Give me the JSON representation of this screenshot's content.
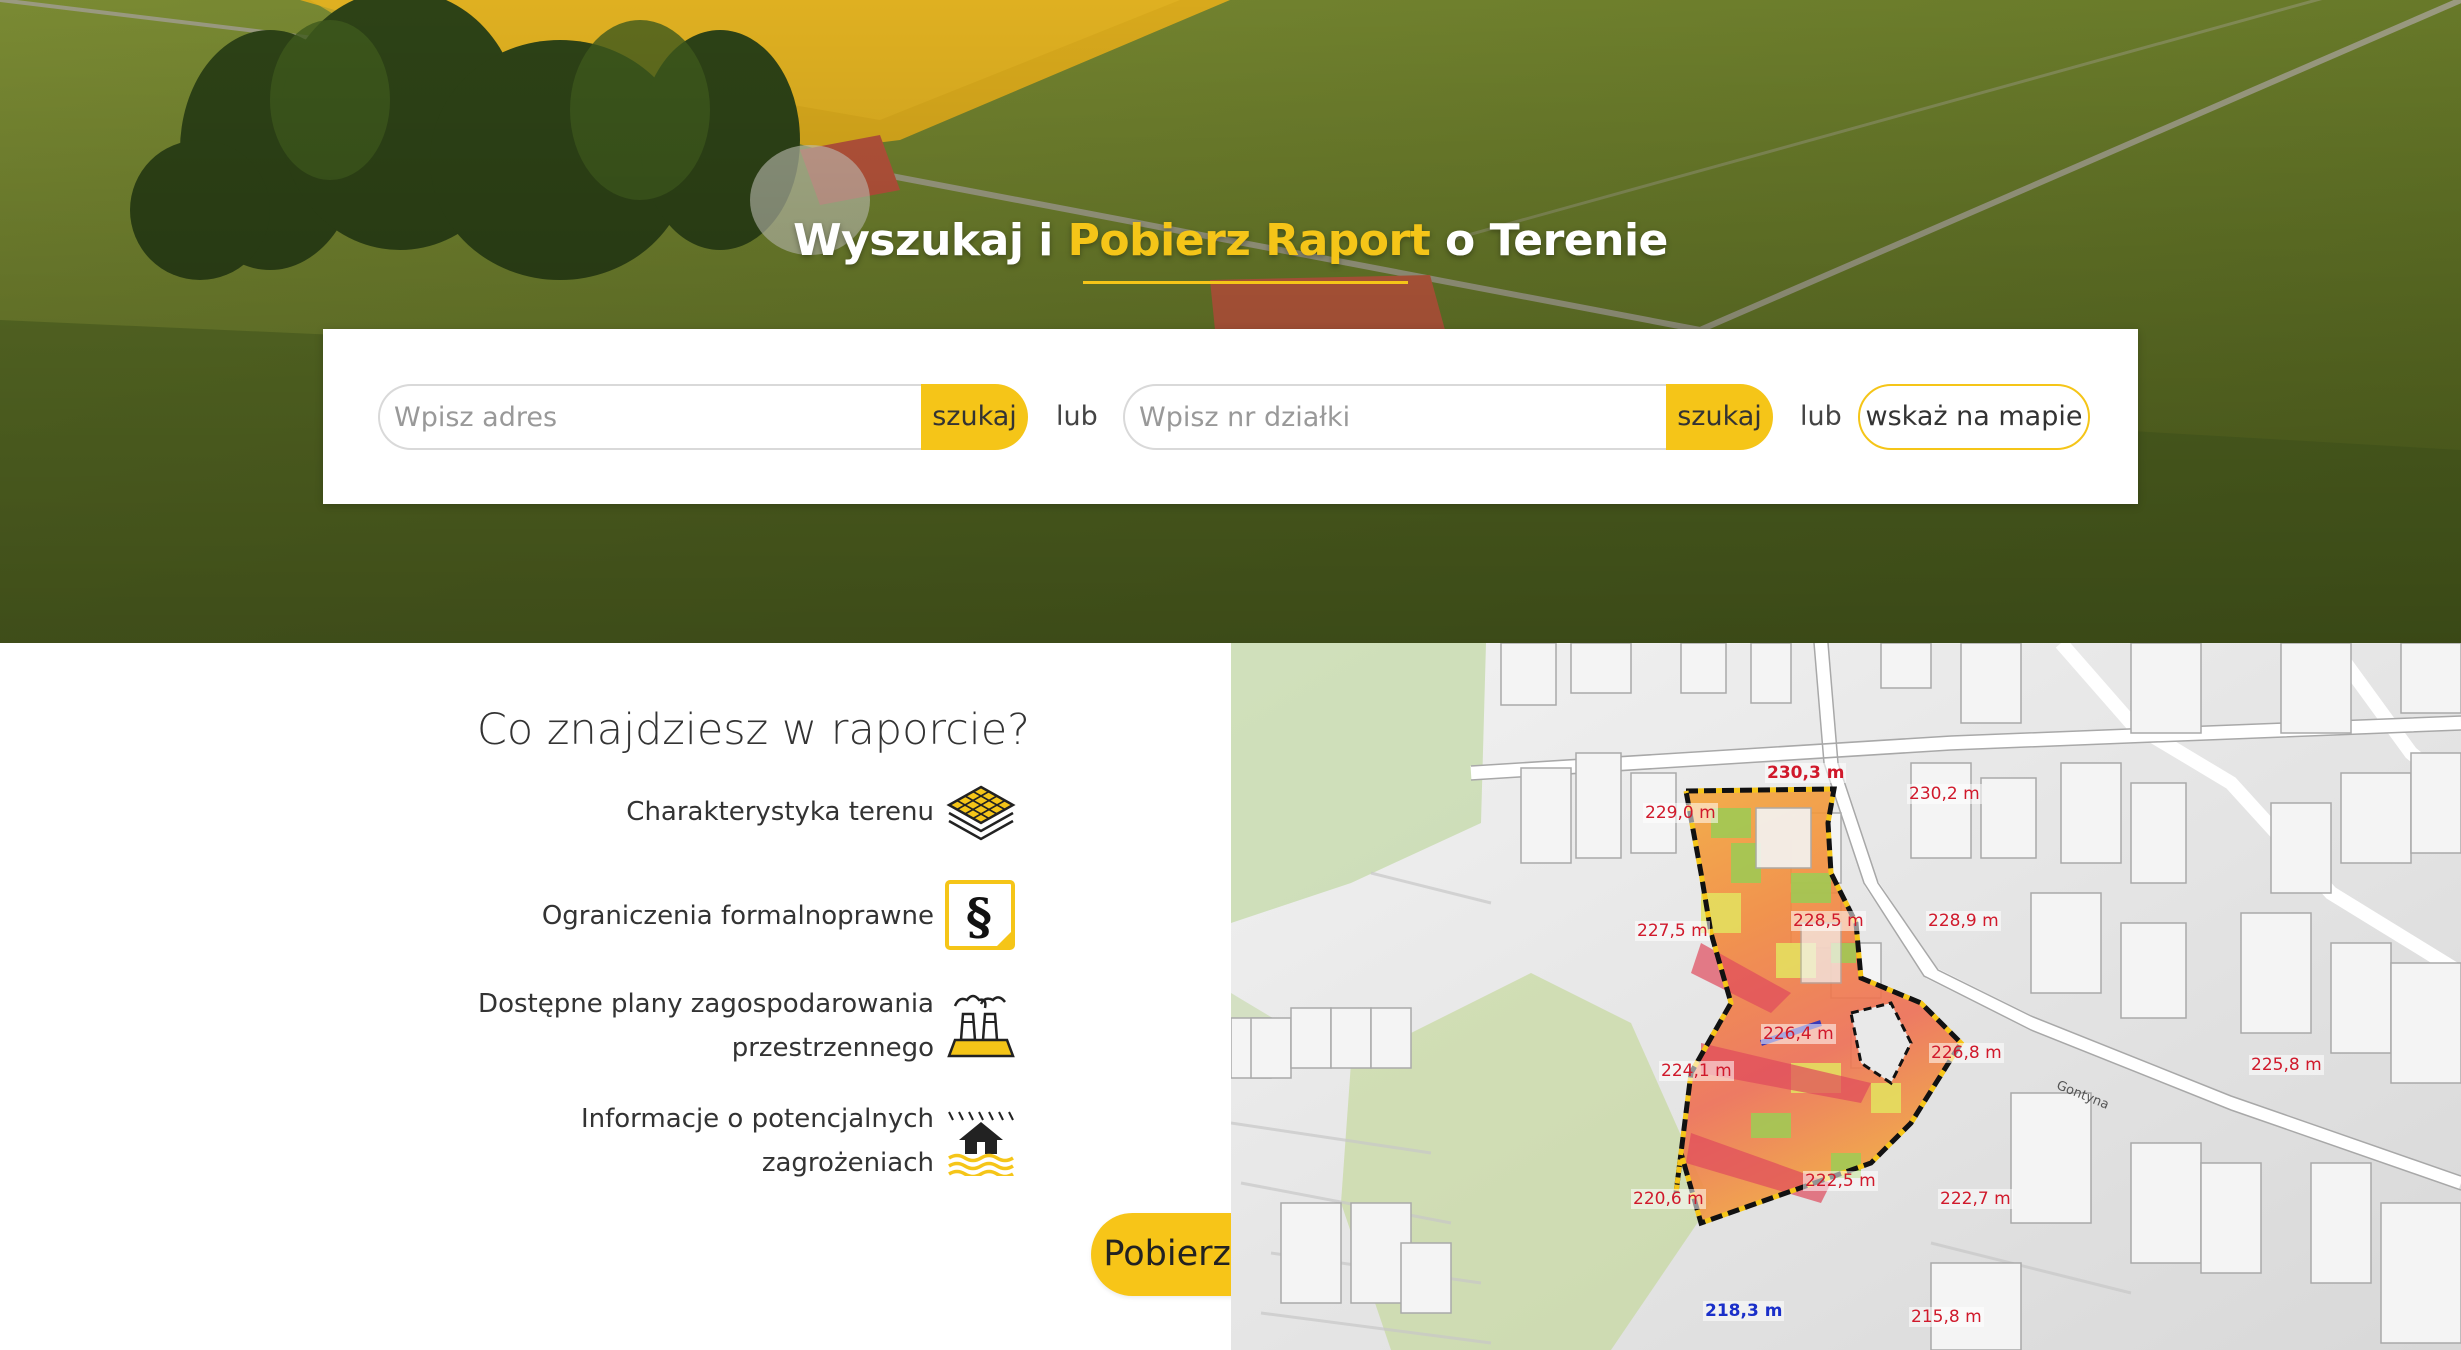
{
  "hero": {
    "title_part1": "Wyszukaj i ",
    "title_highlight": "Pobierz Raport",
    "title_part2": " o Terenie"
  },
  "search": {
    "address_placeholder": "Wpisz adres",
    "address_button": "szukaj",
    "or_1": "lub",
    "parcel_placeholder": "Wpisz nr działki",
    "parcel_button": "szukaj",
    "or_2": "lub",
    "map_button": "wskaż na mapie"
  },
  "report": {
    "heading": "Co znajdziesz w raporcie?",
    "features": [
      {
        "line1": "Charakterystyka terenu",
        "line2": "",
        "icon": "terrain-grid-icon"
      },
      {
        "line1": "Ograniczenia formalnoprawne",
        "line2": "",
        "icon": "paragraph-icon"
      },
      {
        "line1": "Dostępne plany zagospodarowania",
        "line2": "przestrzennego",
        "icon": "factory-plan-icon"
      },
      {
        "line1": "Informacje o potencjalnych",
        "line2": "zagrożeniach",
        "icon": "flood-house-icon"
      }
    ],
    "cta": "Pobierz raport"
  },
  "map": {
    "elevations": [
      "230,3 m",
      "229,0 m",
      "230,2 m",
      "228,5 m",
      "228,9 m",
      "227,5 m",
      "226,4 m",
      "226,8 m",
      "225,8 m",
      "224,1 m",
      "222,5 m",
      "220,6 m",
      "222,7 m",
      "218,3 m",
      "215,8 m"
    ],
    "street_name": "Gontyna"
  },
  "colors": {
    "accent": "#f5c518",
    "elevation_label": "#d0192b",
    "lowest_point": "#1a2fc9"
  }
}
